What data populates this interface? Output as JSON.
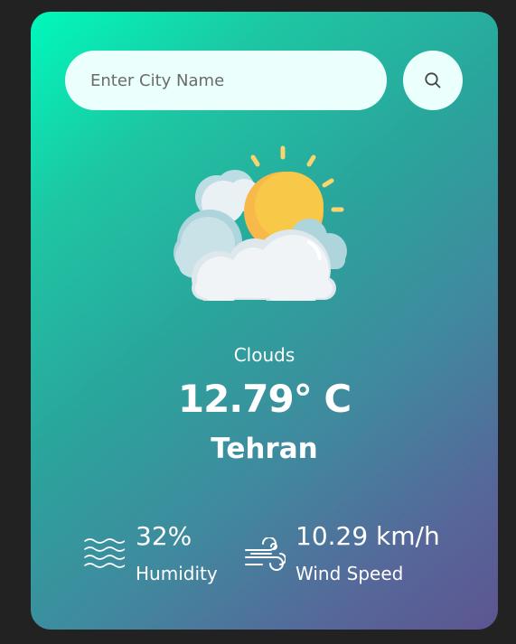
{
  "search": {
    "placeholder": "Enter City Name",
    "button_icon": "search-icon"
  },
  "weather": {
    "icon": "cloudy-sun-icon",
    "condition": "Clouds",
    "temperature": "12.79° C",
    "city": "Tehran"
  },
  "details": {
    "humidity": {
      "icon": "waves-icon",
      "value": "32%",
      "label": "Humidity"
    },
    "wind": {
      "icon": "wind-icon",
      "value": "10.29 km/h",
      "label": "Wind Speed"
    }
  },
  "colors": {
    "page_background": "#222222",
    "gradient_start": "#00f9bb",
    "gradient_end": "#5d5591",
    "input_background": "#ebfffc",
    "text": "#ffffff"
  }
}
